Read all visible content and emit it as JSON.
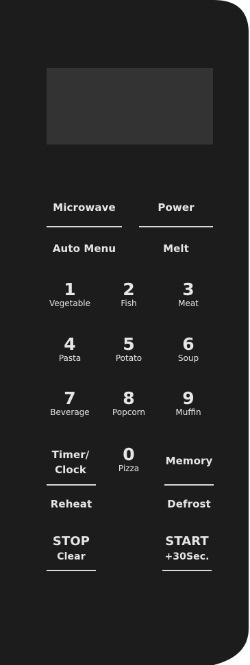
{
  "panel": {
    "background_color": "#1c1c1c",
    "text_color": "#e6e6e6",
    "display_color": "#333333"
  },
  "buttons": {
    "microwave": "Microwave",
    "power": "Power",
    "auto_menu": "Auto Menu",
    "melt": "Melt",
    "timer_clock_line1": "Timer/",
    "timer_clock_line2": "Clock",
    "memory": "Memory",
    "reheat": "Reheat",
    "defrost": "Defrost",
    "stop": "STOP",
    "clear": "Clear",
    "start": "START",
    "plus30": "+30Sec."
  },
  "keypad": [
    {
      "digit": "1",
      "label": "Vegetable"
    },
    {
      "digit": "2",
      "label": "Fish"
    },
    {
      "digit": "3",
      "label": "Meat"
    },
    {
      "digit": "4",
      "label": "Pasta"
    },
    {
      "digit": "5",
      "label": "Potato"
    },
    {
      "digit": "6",
      "label": "Soup"
    },
    {
      "digit": "7",
      "label": "Beverage"
    },
    {
      "digit": "8",
      "label": "Popcorn"
    },
    {
      "digit": "9",
      "label": "Muffin"
    },
    {
      "digit": "0",
      "label": "Pizza"
    }
  ]
}
